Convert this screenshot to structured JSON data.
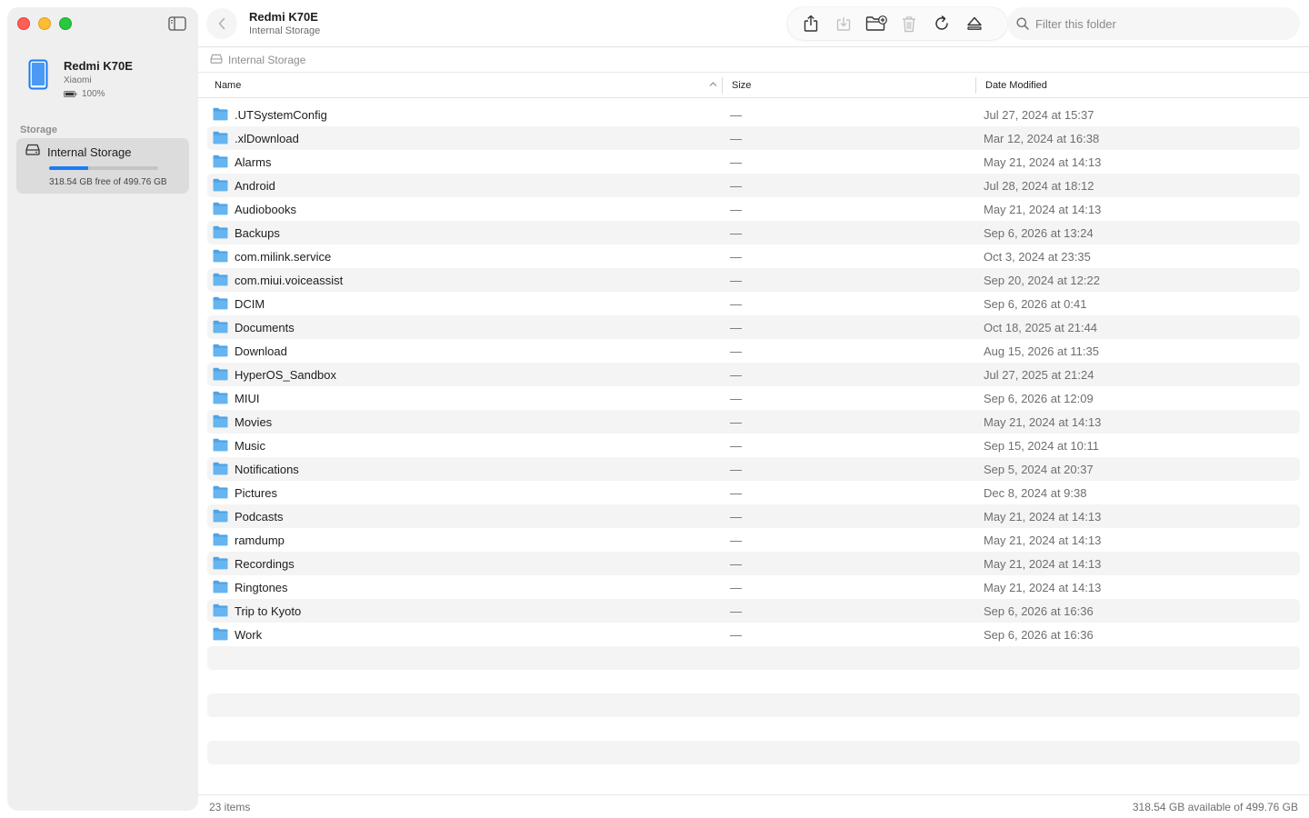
{
  "sidebar": {
    "device_name": "Redmi K70E",
    "device_brand": "Xiaomi",
    "battery": "100%",
    "section_label": "Storage",
    "storage_item": {
      "label": "Internal Storage",
      "free_text": "318.54 GB free of 499.76 GB",
      "used_fraction": 0.36
    }
  },
  "toolbar": {
    "title": "Redmi K70E",
    "subtitle": "Internal Storage",
    "actions": [
      "share-icon",
      "download-icon",
      "new-folder-icon",
      "trash-icon",
      "refresh-icon",
      "eject-icon"
    ],
    "search_placeholder": "Filter this folder"
  },
  "pathbar": {
    "label": "Internal Storage"
  },
  "table": {
    "headers": {
      "name": "Name",
      "size": "Size",
      "date": "Date Modified"
    },
    "rows": [
      {
        "name": ".UTSystemConfig",
        "size": "—",
        "date": "Jul 27, 2024 at 15:37"
      },
      {
        "name": ".xlDownload",
        "size": "—",
        "date": "Mar 12, 2024 at 16:38"
      },
      {
        "name": "Alarms",
        "size": "—",
        "date": "May 21, 2024 at 14:13"
      },
      {
        "name": "Android",
        "size": "—",
        "date": "Jul 28, 2024 at 18:12"
      },
      {
        "name": "Audiobooks",
        "size": "—",
        "date": "May 21, 2024 at 14:13"
      },
      {
        "name": "Backups",
        "size": "—",
        "date": "Sep 6, 2026 at 13:24"
      },
      {
        "name": "com.milink.service",
        "size": "—",
        "date": "Oct 3, 2024 at 23:35"
      },
      {
        "name": "com.miui.voiceassist",
        "size": "—",
        "date": "Sep 20, 2024 at 12:22"
      },
      {
        "name": "DCIM",
        "size": "—",
        "date": "Sep 6, 2026 at 0:41"
      },
      {
        "name": "Documents",
        "size": "—",
        "date": "Oct 18, 2025 at 21:44"
      },
      {
        "name": "Download",
        "size": "—",
        "date": "Aug 15, 2026 at 11:35"
      },
      {
        "name": "HyperOS_Sandbox",
        "size": "—",
        "date": "Jul 27, 2025 at 21:24"
      },
      {
        "name": "MIUI",
        "size": "—",
        "date": "Sep 6, 2026 at 12:09"
      },
      {
        "name": "Movies",
        "size": "—",
        "date": "May 21, 2024 at 14:13"
      },
      {
        "name": "Music",
        "size": "—",
        "date": "Sep 15, 2024 at 10:11"
      },
      {
        "name": "Notifications",
        "size": "—",
        "date": "Sep 5, 2024 at 20:37"
      },
      {
        "name": "Pictures",
        "size": "—",
        "date": "Dec 8, 2024 at 9:38"
      },
      {
        "name": "Podcasts",
        "size": "—",
        "date": "May 21, 2024 at 14:13"
      },
      {
        "name": "ramdump",
        "size": "—",
        "date": "May 21, 2024 at 14:13"
      },
      {
        "name": "Recordings",
        "size": "—",
        "date": "May 21, 2024 at 14:13"
      },
      {
        "name": "Ringtones",
        "size": "—",
        "date": "May 21, 2024 at 14:13"
      },
      {
        "name": "Trip to Kyoto",
        "size": "—",
        "date": "Sep 6, 2026 at 16:36"
      },
      {
        "name": "Work",
        "size": "—",
        "date": "Sep 6, 2026 at 16:36"
      }
    ]
  },
  "status": {
    "item_count": "23 items",
    "available": "318.54 GB available of 499.76 GB"
  },
  "colors": {
    "accent": "#1a7cf5",
    "folder": "#4fa3e6",
    "close": "#ff5f57",
    "minimize": "#febc2e",
    "maximize": "#28c840"
  }
}
